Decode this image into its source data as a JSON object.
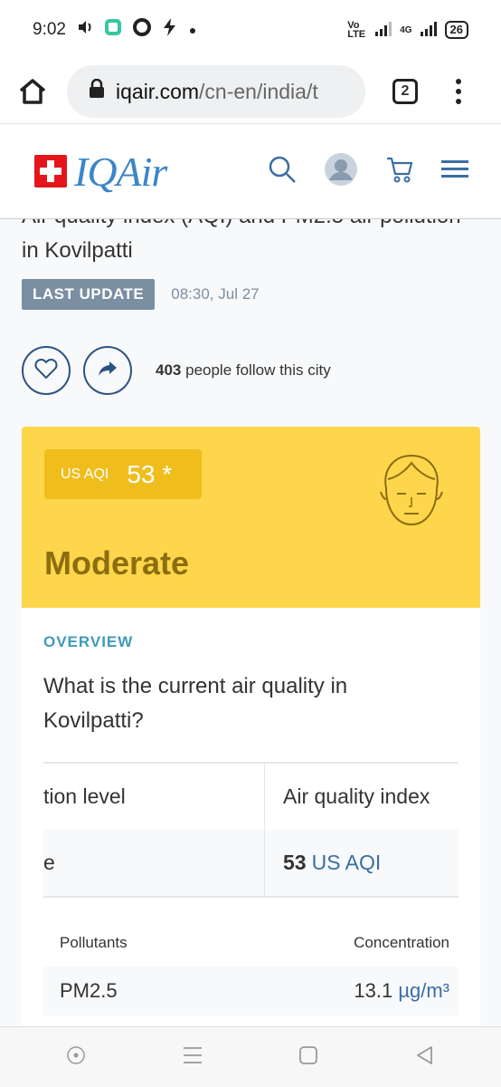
{
  "status_bar": {
    "time": "9:02",
    "network": "Vo LTE",
    "signal": "4G",
    "battery": "26"
  },
  "browser": {
    "url_host": "iqair.com",
    "url_path": "/cn-en/india/t",
    "tab_count": "2"
  },
  "header": {
    "logo_text": "IQAir"
  },
  "page": {
    "title_partial": "Air quality index (AQI) and PM2.5 air pollution",
    "title_line2": "in Kovilpatti",
    "last_update_label": "LAST UPDATE",
    "last_update_time": "08:30, Jul 27",
    "follow_count": "403",
    "follow_text": "people follow this city"
  },
  "aqi": {
    "label": "US AQI",
    "value": "53 *",
    "status": "Moderate",
    "card_color": "#fdd64b"
  },
  "overview": {
    "label": "OVERVIEW",
    "question": "What is the current air quality in Kovilpatti?",
    "table": {
      "col1_header": "tion level",
      "col2_header": "Air quality index",
      "col1_value": "e",
      "col2_value_num": "53",
      "col2_value_unit": "US AQI"
    },
    "pollutants": {
      "header_left": "Pollutants",
      "header_right": "Concentration",
      "rows": [
        {
          "name": "PM2.5",
          "value": "13.1",
          "unit": "µg/m³"
        }
      ]
    }
  }
}
